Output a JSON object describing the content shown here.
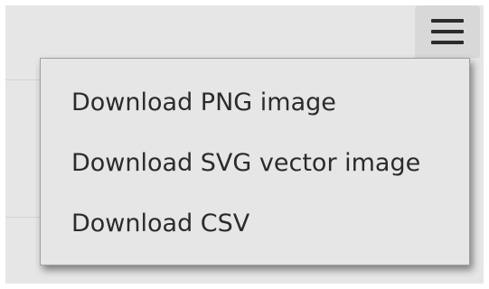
{
  "menu_button": {
    "icon": "hamburger-menu-icon"
  },
  "context_menu": {
    "items": [
      {
        "label": "Download PNG image"
      },
      {
        "label": "Download SVG vector image"
      },
      {
        "label": "Download CSV"
      }
    ]
  },
  "colors": {
    "background": "#e6e6e6",
    "button_hover": "#d8d8d8",
    "menu_border": "#9e9e9e",
    "text": "#2b2b2b"
  }
}
